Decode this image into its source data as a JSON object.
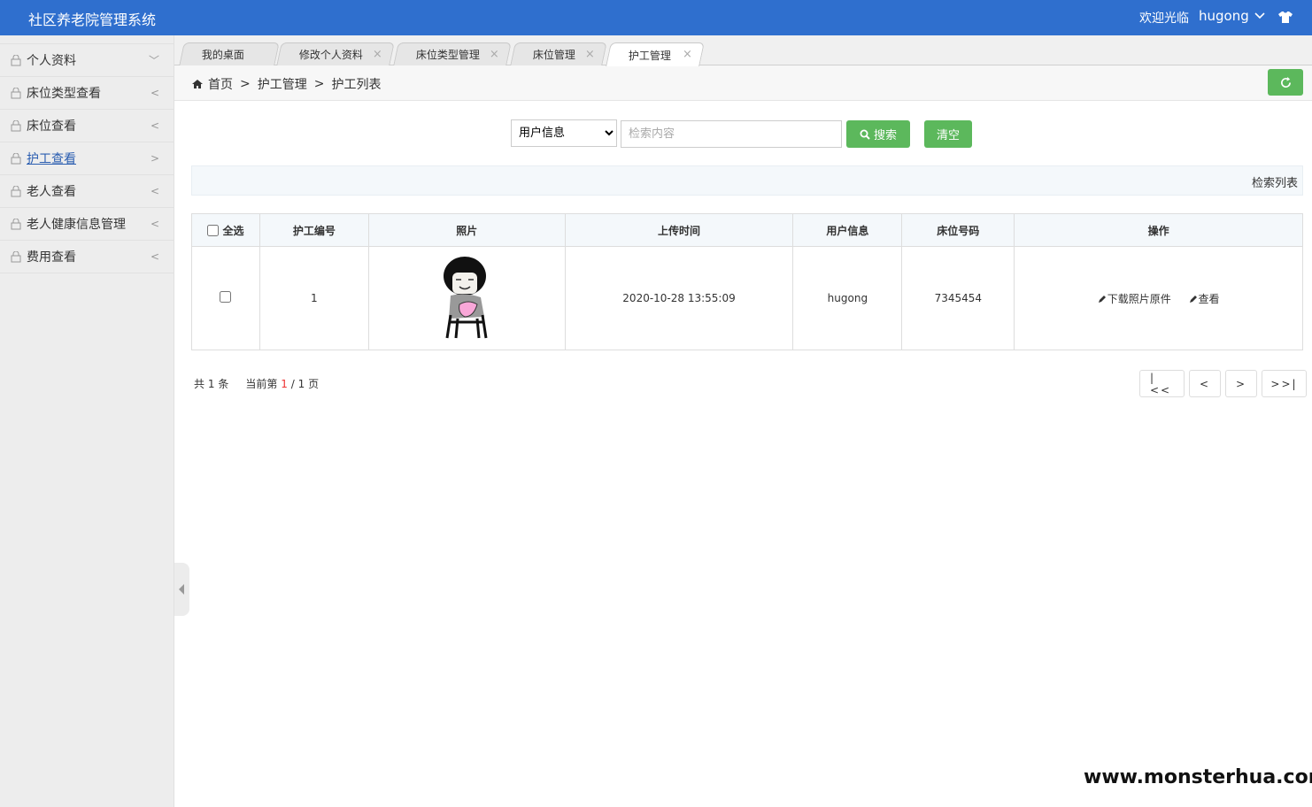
{
  "app": {
    "title": "社区养老院管理系统",
    "welcome": "欢迎光临",
    "username": "hugong"
  },
  "sidebar": {
    "items": [
      {
        "label": "个人资料",
        "arrow": "﹀"
      },
      {
        "label": "床位类型查看",
        "arrow": "<"
      },
      {
        "label": "床位查看",
        "arrow": "<"
      },
      {
        "label": "护工查看",
        "arrow": ">"
      },
      {
        "label": "老人查看",
        "arrow": "<"
      },
      {
        "label": "老人健康信息管理",
        "arrow": "<"
      },
      {
        "label": "费用查看",
        "arrow": "<"
      }
    ]
  },
  "tabs": [
    {
      "label": "我的桌面"
    },
    {
      "label": "修改个人资料",
      "close": "×"
    },
    {
      "label": "床位类型管理",
      "close": "×"
    },
    {
      "label": "床位管理",
      "close": "×"
    },
    {
      "label": "护工管理",
      "close": "×"
    }
  ],
  "breadcrumb": {
    "home": "首页",
    "sep1": ">",
    "level1": "护工管理",
    "sep2": ">",
    "level2": "护工列表"
  },
  "search": {
    "field_selected": "用户信息",
    "placeholder": "检索内容",
    "search_label": "搜索",
    "clear_label": "清空"
  },
  "list_title": "检索列表",
  "table": {
    "headers": {
      "select_all": "全选",
      "id": "护工编号",
      "photo": "照片",
      "upload_time": "上传时间",
      "user_info": "用户信息",
      "bed_no": "床位号码",
      "actions": "操作"
    },
    "rows": [
      {
        "id": "1",
        "upload_time": "2020-10-28 13:55:09",
        "user_info": "hugong",
        "bed_no": "7345454",
        "download": "下载照片原件",
        "view": "查看"
      }
    ]
  },
  "pager": {
    "total_prefix": "共",
    "total": "1",
    "total_suffix": "条",
    "current_prefix": "当前第",
    "current": "1",
    "slash": "/",
    "pages": "1",
    "pages_suffix": "页",
    "first": "|<<",
    "prev": "<",
    "next": ">",
    "last": ">>|"
  },
  "watermark": "www.monsterhua.com",
  "colors": {
    "header": "#2f6fce",
    "green": "#5cb85c",
    "active_link": "#2a5db0"
  }
}
